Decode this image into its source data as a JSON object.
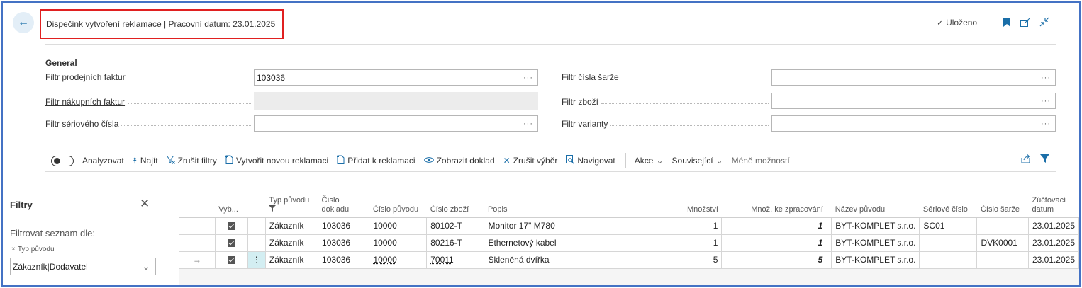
{
  "header": {
    "title": "Dispečink vytvoření reklamace | Pracovní datum: 23.01.2025",
    "saved_label": "Uloženo"
  },
  "general": {
    "section_title": "General",
    "left_fields": [
      {
        "label": "Filtr prodejních faktur",
        "value": "103036"
      },
      {
        "label": "Filtr nákupních faktur",
        "value": ""
      },
      {
        "label": "Filtr sériového čísla",
        "value": ""
      }
    ],
    "right_fields": [
      {
        "label": "Filtr čísla šarže",
        "value": ""
      },
      {
        "label": "Filtr zboží",
        "value": ""
      },
      {
        "label": "Filtr varianty",
        "value": ""
      }
    ],
    "ellipsis": "···"
  },
  "toolbar": {
    "analyze": "Analyzovat",
    "find": "Najít",
    "clear_filters": "Zrušit filtry",
    "create_new": "Vytvořit novou reklamaci",
    "add_to": "Přidat k reklamaci",
    "show_doc": "Zobrazit doklad",
    "cancel_sel": "Zrušit výběr",
    "navigate": "Navigovat",
    "actions": "Akce",
    "related": "Související",
    "fewer": "Méně možností"
  },
  "filter_pane": {
    "title": "Filtry",
    "filter_by": "Filtrovat seznam dle:",
    "field_name": "Typ původu",
    "field_value": "Zákazník|Dodavatel"
  },
  "grid": {
    "columns": {
      "select": "Vyb...",
      "origin_type": "Typ původu",
      "doc_no": "Číslo dokladu",
      "origin_no": "Číslo původu",
      "item_no": "Číslo zboží",
      "description": "Popis",
      "qty": "Množství",
      "qty_to_process": "Množ. ke zpracování",
      "origin_name": "Název původu",
      "serial_no": "Sériové číslo",
      "lot_no": "Číslo šarže",
      "posting_date": "Zúčtovací datum"
    },
    "rows": [
      {
        "origin_type": "Zákazník",
        "doc_no": "103036",
        "origin_no": "10000",
        "item_no": "80102-T",
        "description": "Monitor 17\" M780",
        "qty": "1",
        "qty_to_process": "1",
        "origin_name": "BYT-KOMPLET s.r.o.",
        "serial_no": "SC01",
        "lot_no": "",
        "posting_date": "23.01.2025"
      },
      {
        "origin_type": "Zákazník",
        "doc_no": "103036",
        "origin_no": "10000",
        "item_no": "80216-T",
        "description": "Ethernetový kabel",
        "qty": "1",
        "qty_to_process": "1",
        "origin_name": "BYT-KOMPLET s.r.o.",
        "serial_no": "",
        "lot_no": "DVK0001",
        "posting_date": "23.01.2025"
      },
      {
        "origin_type": "Zákazník",
        "doc_no": "103036",
        "origin_no": "10000",
        "item_no": "70011",
        "description": "Skleněná dvířka",
        "qty": "5",
        "qty_to_process": "5",
        "origin_name": "BYT-KOMPLET s.r.o.",
        "serial_no": "",
        "lot_no": "",
        "posting_date": "23.01.2025"
      }
    ]
  },
  "colors": {
    "accent": "#1a6ea8",
    "highlight_border": "#e02020",
    "frame_border": "#4472c4"
  }
}
